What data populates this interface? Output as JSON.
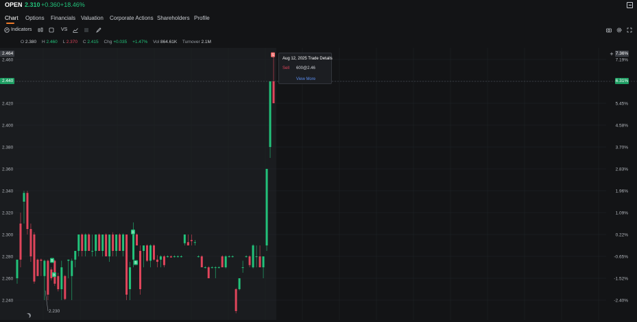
{
  "header": {
    "symbol": "OPEN",
    "price": "2.310",
    "change": "+0.360",
    "change_pct": "+18.46%"
  },
  "tabs": [
    {
      "label": "Chart",
      "active": true
    },
    {
      "label": "Options"
    },
    {
      "label": "Financials"
    },
    {
      "label": "Valuation"
    },
    {
      "label": "Corporate Actions"
    },
    {
      "label": "Shareholders"
    },
    {
      "label": "Profile"
    }
  ],
  "toolbar": {
    "indicators_label": "Indicators",
    "vs_label": "VS",
    "icons": [
      "indicators-icon",
      "candle-type-icon",
      "rect-icon",
      "compare-icon",
      "area-chart-icon",
      "list-icon",
      "draw-pen-icon",
      "camera-icon",
      "settings-icon",
      "fullscreen-icon"
    ]
  },
  "ohlc": {
    "o_label": "O",
    "o": "2.380",
    "h_label": "H",
    "h": "2.460",
    "l_label": "L",
    "l": "2.370",
    "c_label": "C",
    "c": "2.415",
    "chg_label": "Chg",
    "chg": "+0.035",
    "chgp": "+1.47%",
    "vol_label": "Vol",
    "vol": "864.61K",
    "turnover_label": "Turnover",
    "turnover": "2.1M"
  },
  "axis": {
    "left_ticks": [
      "2.460",
      "2.440",
      "2.420",
      "2.400",
      "2.380",
      "2.360",
      "2.340",
      "2.320",
      "2.300",
      "2.280",
      "2.260",
      "2.240"
    ],
    "right_ticks": [
      "7.19%",
      "6.31%",
      "5.45%",
      "4.58%",
      "3.70%",
      "2.83%",
      "1.96%",
      "1.09%",
      "0.22%",
      "-0.65%",
      "-1.52%",
      "-2.40%"
    ],
    "top_badge_left": "2.464",
    "top_badge_right": "7.36%",
    "current_badge_left": "2.440",
    "current_badge_right": "6.31%",
    "low_marker": "2.230"
  },
  "tooltip": {
    "title": "Aug 12, 2025 Trade Details",
    "side": "Sell",
    "detail": "600@2.46",
    "more": "View More"
  },
  "colors": {
    "up": "#22c27a",
    "down": "#e0455b",
    "accent": "#f07a2a",
    "link": "#5b8def"
  },
  "chart_data": {
    "type": "candlestick",
    "ylim": [
      2.228,
      2.466
    ],
    "trade_markers": [
      {
        "label": "B",
        "price": 2.276
      },
      {
        "label": "B",
        "price": 2.263
      },
      {
        "label": "B",
        "price": 2.302
      },
      {
        "label": "B",
        "price": 2.274
      },
      {
        "label": "S",
        "price": 2.464
      }
    ],
    "candles": [
      [
        2.26,
        2.277,
        2.255,
        2.277
      ],
      [
        2.31,
        2.32,
        2.27,
        2.277
      ],
      [
        2.33,
        2.34,
        2.31,
        2.338
      ],
      [
        2.338,
        2.34,
        2.3,
        2.305
      ],
      [
        2.305,
        2.31,
        2.275,
        2.28
      ],
      [
        2.3,
        2.302,
        2.255,
        2.257
      ],
      [
        2.277,
        2.278,
        2.262,
        2.262
      ],
      [
        2.277,
        2.278,
        2.262,
        2.276
      ],
      [
        2.262,
        2.277,
        2.24,
        2.276
      ],
      [
        2.276,
        2.277,
        2.24,
        2.245
      ],
      [
        2.268,
        2.27,
        2.258,
        2.26
      ],
      [
        2.276,
        2.277,
        2.253,
        2.255
      ],
      [
        2.262,
        2.265,
        2.248,
        2.25
      ],
      [
        2.25,
        2.276,
        2.24,
        2.27
      ],
      [
        2.262,
        2.263,
        2.24,
        2.241
      ],
      [
        2.276,
        2.277,
        2.26,
        2.277
      ],
      [
        2.262,
        2.278,
        2.24,
        2.276
      ],
      [
        2.277,
        2.285,
        2.27,
        2.285
      ],
      [
        2.285,
        2.3,
        2.28,
        2.3
      ],
      [
        2.3,
        2.301,
        2.28,
        2.285
      ],
      [
        2.285,
        2.301,
        2.28,
        2.3
      ],
      [
        2.3,
        2.301,
        2.285,
        2.285
      ],
      [
        2.285,
        2.3,
        2.28,
        2.285
      ],
      [
        2.285,
        2.3,
        2.28,
        2.3
      ],
      [
        2.3,
        2.301,
        2.285,
        2.285
      ],
      [
        2.285,
        2.3,
        2.28,
        2.3
      ],
      [
        2.3,
        2.301,
        2.28,
        2.28
      ],
      [
        2.28,
        2.3,
        2.275,
        2.3
      ],
      [
        2.3,
        2.302,
        2.28,
        2.285
      ],
      [
        2.285,
        2.3,
        2.28,
        2.3
      ],
      [
        2.3,
        2.301,
        2.285,
        2.285
      ],
      [
        2.285,
        2.301,
        2.28,
        2.3
      ],
      [
        2.3,
        2.3,
        2.24,
        2.245
      ],
      [
        2.25,
        2.275,
        2.24,
        2.27
      ],
      [
        2.277,
        2.311,
        2.27,
        2.3
      ],
      [
        2.3,
        2.301,
        2.29,
        2.29
      ],
      [
        2.285,
        2.29,
        2.245,
        2.25
      ],
      [
        2.285,
        2.29,
        2.27,
        2.29
      ],
      [
        2.29,
        2.291,
        2.275,
        2.276
      ],
      [
        2.276,
        2.291,
        2.27,
        2.29
      ],
      [
        2.29,
        2.291,
        2.276,
        2.277
      ],
      [
        2.277,
        2.281,
        2.27,
        2.275
      ],
      [
        2.277,
        2.281,
        2.27,
        2.28
      ],
      [
        2.28,
        2.281,
        2.27,
        2.272
      ],
      [
        2.28,
        2.281,
        2.279,
        2.28
      ],
      [
        2.28,
        2.281,
        2.279,
        2.279
      ],
      [
        2.28,
        2.281,
        2.279,
        2.28
      ],
      [
        2.28,
        2.281,
        2.279,
        2.28
      ],
      [
        2.28,
        2.281,
        2.279,
        2.28
      ],
      [
        2.292,
        2.3,
        2.29,
        2.3
      ],
      [
        2.293,
        2.3,
        2.29,
        2.29
      ],
      [
        2.295,
        2.3,
        2.29,
        2.294
      ],
      [
        2.293,
        2.295,
        2.29,
        2.293
      ],
      [
        2.28,
        2.281,
        2.279,
        2.28
      ],
      [
        2.28,
        2.281,
        2.27,
        2.27
      ],
      [
        2.27,
        2.271,
        2.269,
        2.27
      ],
      [
        2.27,
        2.271,
        2.26,
        2.26
      ],
      [
        2.27,
        2.271,
        2.269,
        2.27
      ],
      [
        2.27,
        2.271,
        2.26,
        2.27
      ],
      [
        2.27,
        2.271,
        2.269,
        2.27
      ],
      [
        2.28,
        2.281,
        2.27,
        2.27
      ],
      [
        2.27,
        2.281,
        2.269,
        2.28
      ],
      [
        2.28,
        2.281,
        2.279,
        2.28
      ],
      [
        2.28,
        2.281,
        2.279,
        2.28
      ],
      [
        2.25,
        2.251,
        2.228,
        2.23
      ],
      [
        2.25,
        2.26,
        2.249,
        2.26
      ],
      [
        2.27,
        2.276,
        2.265,
        2.27
      ],
      [
        2.28,
        2.281,
        2.279,
        2.28
      ],
      [
        2.28,
        2.281,
        2.27,
        2.272
      ],
      [
        2.27,
        2.291,
        2.269,
        2.29
      ],
      [
        2.28,
        2.29,
        2.27,
        2.28
      ],
      [
        2.28,
        2.29,
        2.27,
        2.27
      ],
      [
        2.27,
        2.28,
        2.26,
        2.28
      ],
      [
        2.29,
        2.36,
        2.285,
        2.36
      ],
      [
        2.38,
        2.44,
        2.37,
        2.44
      ],
      [
        2.44,
        2.464,
        2.42,
        2.42
      ]
    ]
  }
}
